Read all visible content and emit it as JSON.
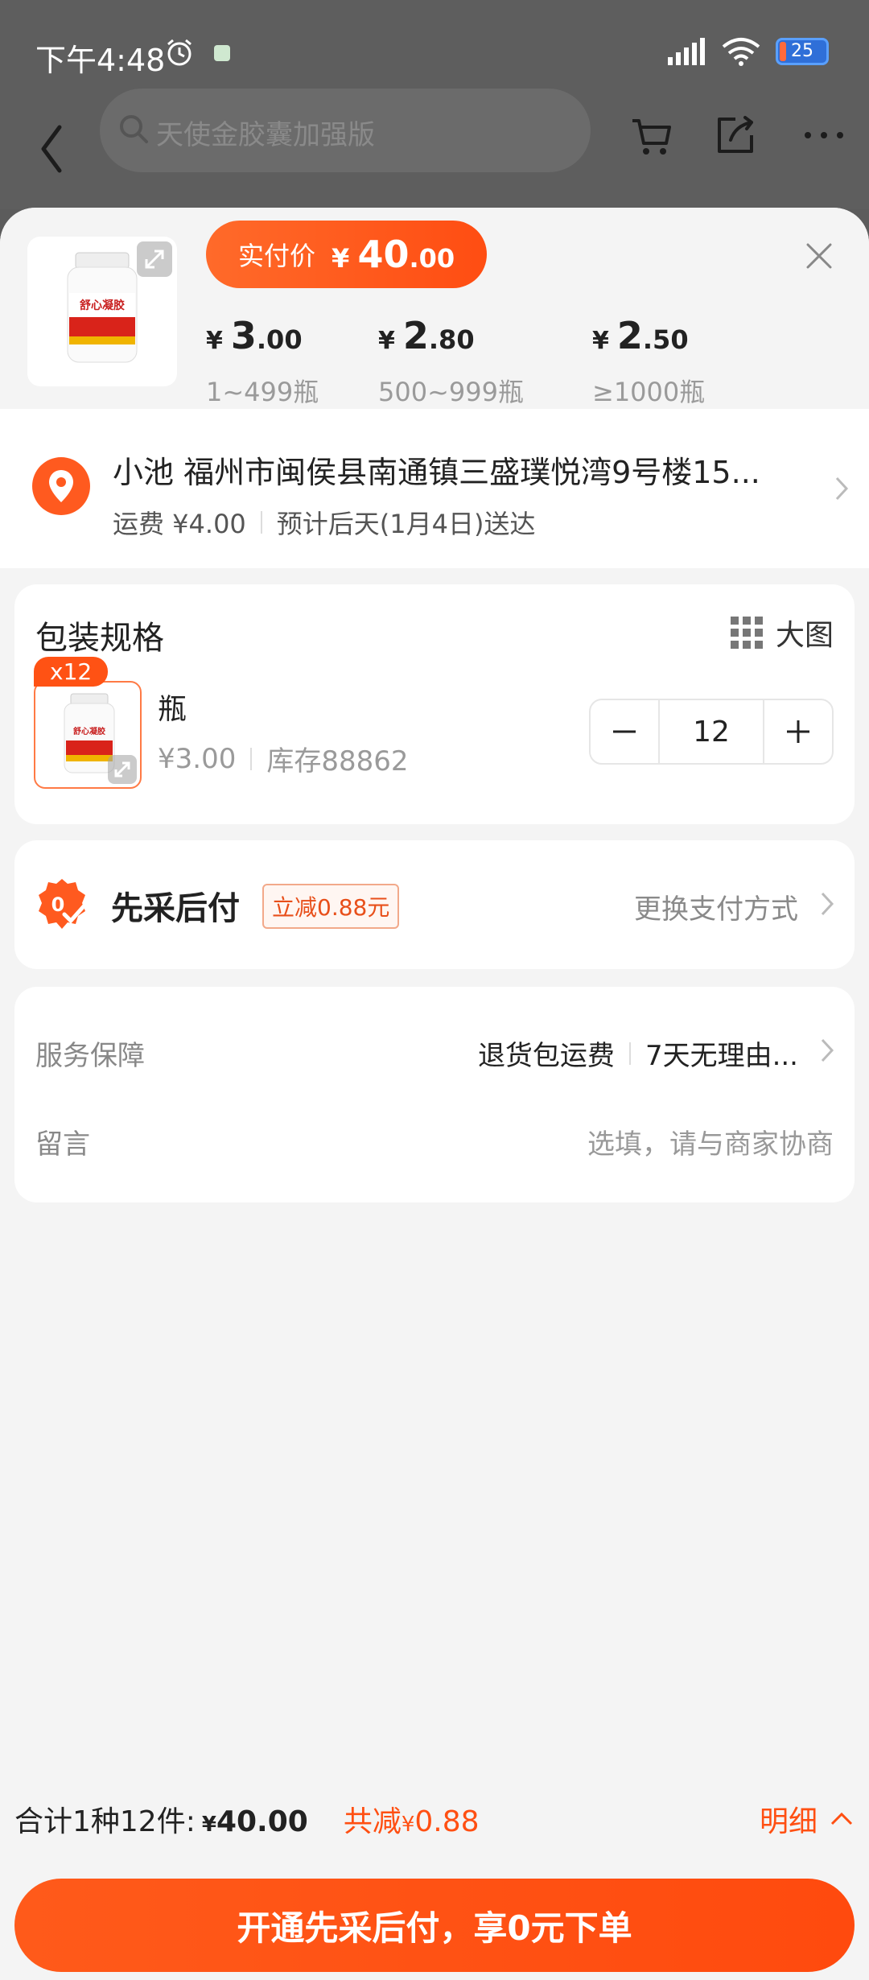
{
  "status_bar": {
    "time": "下午4:48",
    "battery": "25"
  },
  "header": {
    "search_placeholder": "天使金胶囊加强版"
  },
  "product": {
    "actual_price_label": "实付价",
    "actual_price_currency": "¥",
    "actual_price_int": "40",
    "actual_price_dec": ".00",
    "tiers": [
      {
        "currency": "¥",
        "int": "3",
        "dec": ".00",
        "range": "1~499瓶"
      },
      {
        "currency": "¥",
        "int": "2",
        "dec": ".80",
        "range": "500~999瓶"
      },
      {
        "currency": "¥",
        "int": "2",
        "dec": ".50",
        "range": "≥1000瓶"
      }
    ]
  },
  "address": {
    "line1": "小池 福州市闽侯县南通镇三盛璞悦湾9号楼15...",
    "shipping": "运费 ¥4.00",
    "eta": "预计后天(1月4日)送达"
  },
  "spec": {
    "title": "包装规格",
    "big_picture": "大图",
    "badge": "x12",
    "name": "瓶",
    "price": "¥3.00",
    "stock": "库存88862",
    "quantity": "12"
  },
  "payment": {
    "title": "先采后付",
    "badge": "立减0.88元",
    "change": "更换支付方式"
  },
  "service": {
    "label": "服务保障",
    "item1": "退货包运费",
    "item2": "7天无理由...",
    "note_label": "留言",
    "note_placeholder": "选填，请与商家协商"
  },
  "footer": {
    "summary": "合计1种12件:",
    "total_currency": "¥",
    "total": "40.00",
    "discount_label": "共减",
    "discount_currency": "¥",
    "discount": "0.88",
    "detail": "明细",
    "cta": "开通先采后付，享0元下单"
  },
  "colors": {
    "accent": "#ff4f12",
    "sheet_bg": "#f4f4f4",
    "overlay": "#5e5e5e"
  }
}
